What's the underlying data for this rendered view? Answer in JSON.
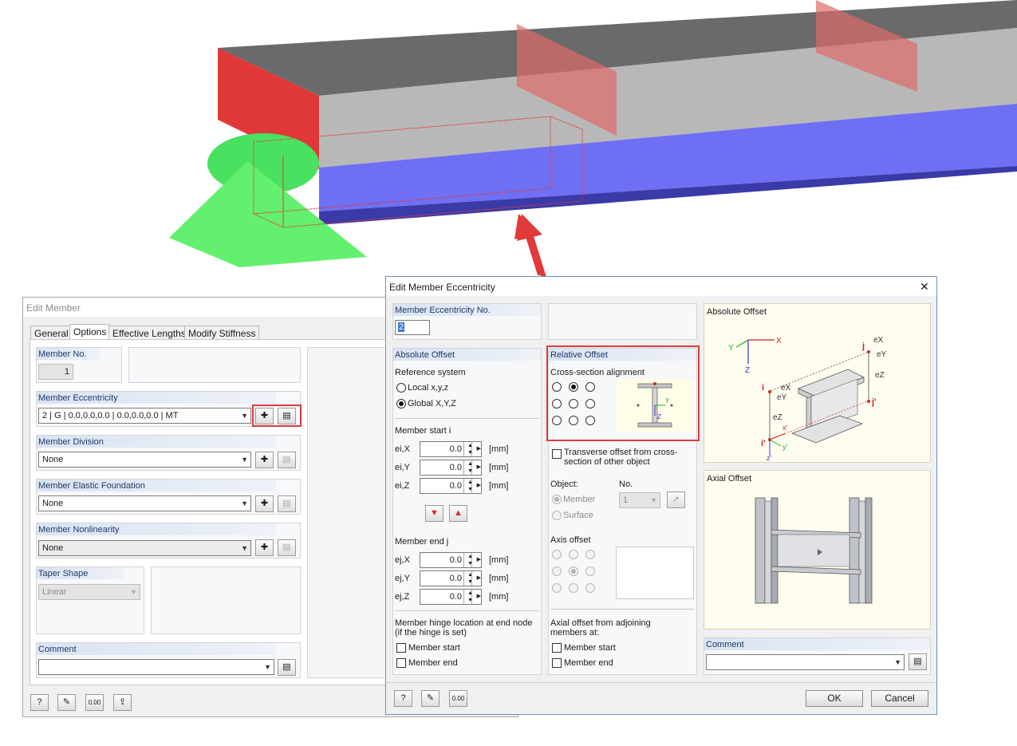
{
  "colors": {
    "red_accent": "#e03a3a",
    "beam_gray": "#8a8a8a",
    "beam_blue": "#6a6af2",
    "support_green": "#3fe05a",
    "header_blue": "#1f3a6b"
  },
  "edit_member": {
    "title": "Edit Member",
    "tabs": [
      "General",
      "Options",
      "Effective Lengths",
      "Modify Stiffness"
    ],
    "member_no": {
      "label": "Member No.",
      "value": "1"
    },
    "eccentricity": {
      "label": "Member Eccentricity",
      "value": "2  |  G  |  0.0,0.0,0.0  |  0.0,0.0,0.0  |  MT"
    },
    "division": {
      "label": "Member Division",
      "value": "None"
    },
    "elastic_foundation": {
      "label": "Member Elastic Foundation",
      "value": "None"
    },
    "nonlinearity": {
      "label": "Member Nonlinearity",
      "value": "None"
    },
    "taper": {
      "label": "Taper Shape",
      "value": "Linear"
    },
    "comment": {
      "label": "Comment",
      "value": ""
    },
    "footer_icons": [
      "help-icon",
      "edit-icon",
      "units-icon",
      "export-icon"
    ]
  },
  "ecc_dialog": {
    "title": "Edit Member Eccentricity",
    "close_glyph": "✕",
    "ecc_no": {
      "label": "Member Eccentricity No.",
      "value": "2"
    },
    "absolute_offset": {
      "label": "Absolute Offset",
      "reference_system_label": "Reference system",
      "options": [
        "Local x,y,z",
        "Global X,Y,Z"
      ],
      "selected": 1,
      "member_start_label": "Member start i",
      "member_end_label": "Member end j",
      "unit": "[mm]",
      "start": [
        {
          "sym": "ei,X",
          "value": "0.0"
        },
        {
          "sym": "ei,Y",
          "value": "0.0"
        },
        {
          "sym": "ei,Z",
          "value": "0.0"
        }
      ],
      "end": [
        {
          "sym": "ej,X",
          "value": "0.0"
        },
        {
          "sym": "ej,Y",
          "value": "0.0"
        },
        {
          "sym": "ej,Z",
          "value": "0.0"
        }
      ],
      "hinge_label": "Member hinge location at end node\n(if the hinge is set)",
      "hinge_options": [
        "Member start",
        "Member end"
      ]
    },
    "relative_offset": {
      "label": "Relative Offset",
      "alignment_label": "Cross-section alignment",
      "alignment_selected": "top-center",
      "transverse_label": "Transverse offset from cross-\nsection of other object",
      "object_label": "Object:",
      "no_label": "No.",
      "objects": [
        "Member",
        "Surface"
      ],
      "object_no": "1",
      "axis_offset_label": "Axis offset",
      "axis_offset_selected": "center",
      "axial_label": "Axial offset from adjoining\nmembers at:",
      "axial_options": [
        "Member start",
        "Member end"
      ]
    },
    "preview": {
      "absolute_title": "Absolute Offset",
      "axial_title": "Axial Offset",
      "diagram_labels": {
        "Y": "Y",
        "X": "X",
        "Z": "Z",
        "j": "j",
        "i": "i",
        "jp": "j'",
        "ip": "i'",
        "ex1": "eX",
        "ey1": "eY",
        "ez1": "eZ",
        "ex2": "eX",
        "ey2": "eY",
        "ez2": "eZ",
        "xp": "x'",
        "yp": "y'",
        "zp": "z'",
        "y_small": "Y",
        "z_small": "Z"
      }
    },
    "comment_label": "Comment",
    "comment_value": "",
    "ok_label": "OK",
    "cancel_label": "Cancel"
  }
}
